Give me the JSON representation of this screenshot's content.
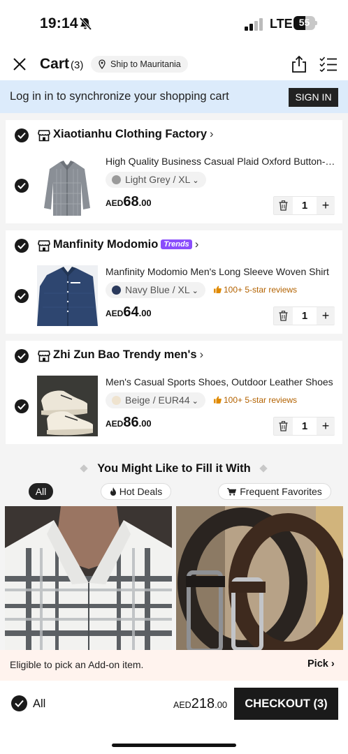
{
  "status_bar": {
    "time": "19:14",
    "network": "LTE",
    "battery": "55",
    "battery_level": 0.55
  },
  "header": {
    "title": "Cart",
    "count": "(3)",
    "ship_to": "Ship to Mauritania"
  },
  "login_banner": {
    "text": "Log in in to synchronize your shopping cart",
    "button": "SIGN IN"
  },
  "cart_items": [
    {
      "store": "Xiaotianhu Clothing Factory",
      "badge": "",
      "title": "High Quality Business Casual Plaid Oxford Button-Down Shirt",
      "variant": "Light Grey / XL",
      "swatch": "#9a9a9a",
      "reviews": "",
      "currency": "AED",
      "price_int": "68",
      "price_dec": ".00",
      "qty": "1"
    },
    {
      "store": "Manfinity Modomio",
      "badge": "Trends",
      "title": "Manfinity Modomio Men's Long Sleeve Woven Shirt",
      "variant": "Navy Blue / XL",
      "swatch": "#2b3a5c",
      "reviews": "100+ 5-star reviews",
      "currency": "AED",
      "price_int": "64",
      "price_dec": ".00",
      "qty": "1"
    },
    {
      "store": "Zhi Zun Bao Trendy men's",
      "badge": "",
      "title": "Men's Casual Sports Shoes, Outdoor Leather Shoes",
      "variant": "Beige / EUR44",
      "swatch": "#efe3cf",
      "reviews": "100+ 5-star reviews",
      "currency": "AED",
      "price_int": "86",
      "price_dec": ".00",
      "qty": "1"
    }
  ],
  "recommendations": {
    "title": "You Might Like to Fill it With",
    "chips": [
      "All",
      "Hot Deals",
      "Frequent Favorites"
    ]
  },
  "addon_bar": {
    "text": "Eligible to pick an Add-on item.",
    "action": "Pick"
  },
  "bottom_bar": {
    "all_label": "All",
    "total_currency": "AED",
    "total_int": "218",
    "total_dec": ".00",
    "checkout_label": "CHECKOUT (3)"
  },
  "colors": {
    "accent": "#1a1a1a",
    "banner_bg": "#dcebfb",
    "trends_badge": "#8a4dfc",
    "review_text": "#b36200",
    "addon_bg": "#fff3ee"
  }
}
